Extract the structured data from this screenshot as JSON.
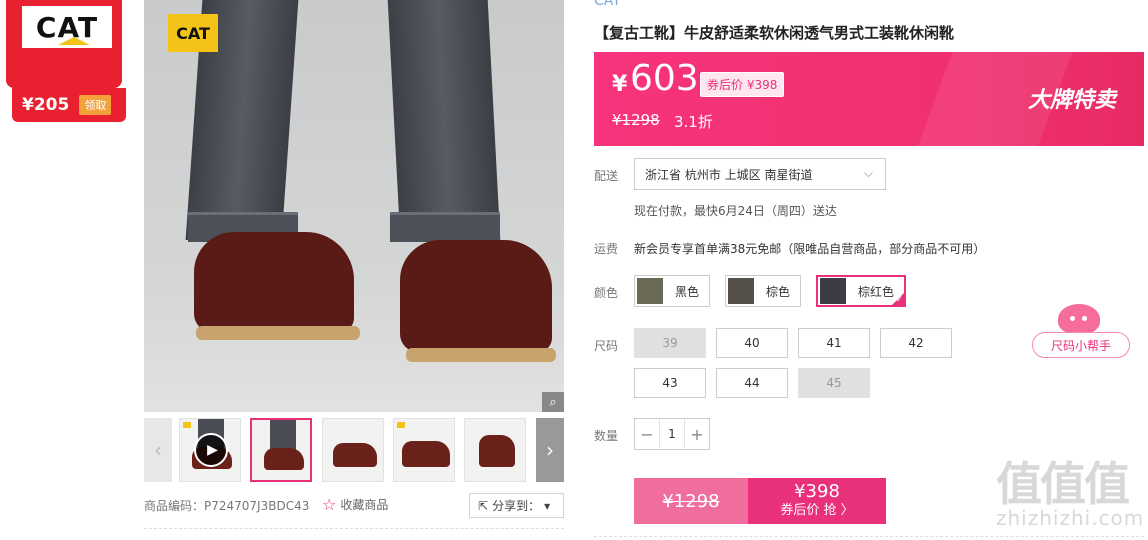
{
  "coupon": {
    "brand": "CAT",
    "amount": "¥205",
    "claim_label": "领取"
  },
  "gallery": {
    "stamp": "CAT",
    "zoom_icon": "magnifier-icon",
    "thumbnails": [
      {
        "name": "video"
      },
      {
        "name": "legs-front"
      },
      {
        "name": "boots-pair"
      },
      {
        "name": "boots-side"
      },
      {
        "name": "boot-single"
      }
    ]
  },
  "meta": {
    "sku_code": "商品编码：P724707J3BDC43",
    "favorite_label": "收藏商品",
    "share_label": "分享到：",
    "share_chevron": "▾"
  },
  "product": {
    "brand": "CAT",
    "title": "【复古工靴】牛皮舒适柔软休闲透气男式工装靴休闲靴"
  },
  "price": {
    "currency": "¥",
    "sale": "603",
    "coupon_tag": "券后价 ¥398",
    "original": "¥1298",
    "discount": "3.1折",
    "promo_word": "大牌特卖",
    "band_color": "#f6337c"
  },
  "shipping": {
    "label": "配送",
    "location": "浙江省 杭州市 上城区 南星街道",
    "deliver_note": "现在付款，最快6月24日（周四）送达",
    "freight_label": "运费",
    "freight_note": "新会员专享首单满38元免邮（限唯品自营商品，部分商品不可用）"
  },
  "colors": {
    "label": "颜色",
    "options": [
      {
        "label": "黑色",
        "swatch": "#6a6a56"
      },
      {
        "label": "棕色",
        "swatch": "#56504a"
      },
      {
        "label": "棕红色",
        "swatch": "#3c3d44"
      }
    ],
    "selected": "棕红色",
    "accent": "#e8307b"
  },
  "sizes": {
    "label": "尺码",
    "options": [
      {
        "value": "39",
        "available": false
      },
      {
        "value": "40",
        "available": true
      },
      {
        "value": "41",
        "available": true
      },
      {
        "value": "42",
        "available": true
      },
      {
        "value": "43",
        "available": true
      },
      {
        "value": "44",
        "available": true
      },
      {
        "value": "45",
        "available": false
      }
    ],
    "helper_label": "尺码小帮手"
  },
  "quantity": {
    "label": "数量",
    "value": "1",
    "minus": "−",
    "plus": "+"
  },
  "buy": {
    "original": "¥1298",
    "price": "¥398",
    "action": "券后价 抢 〉"
  },
  "watermark": {
    "glyphs": "值值值",
    "url": "zhizhizhi.com"
  }
}
